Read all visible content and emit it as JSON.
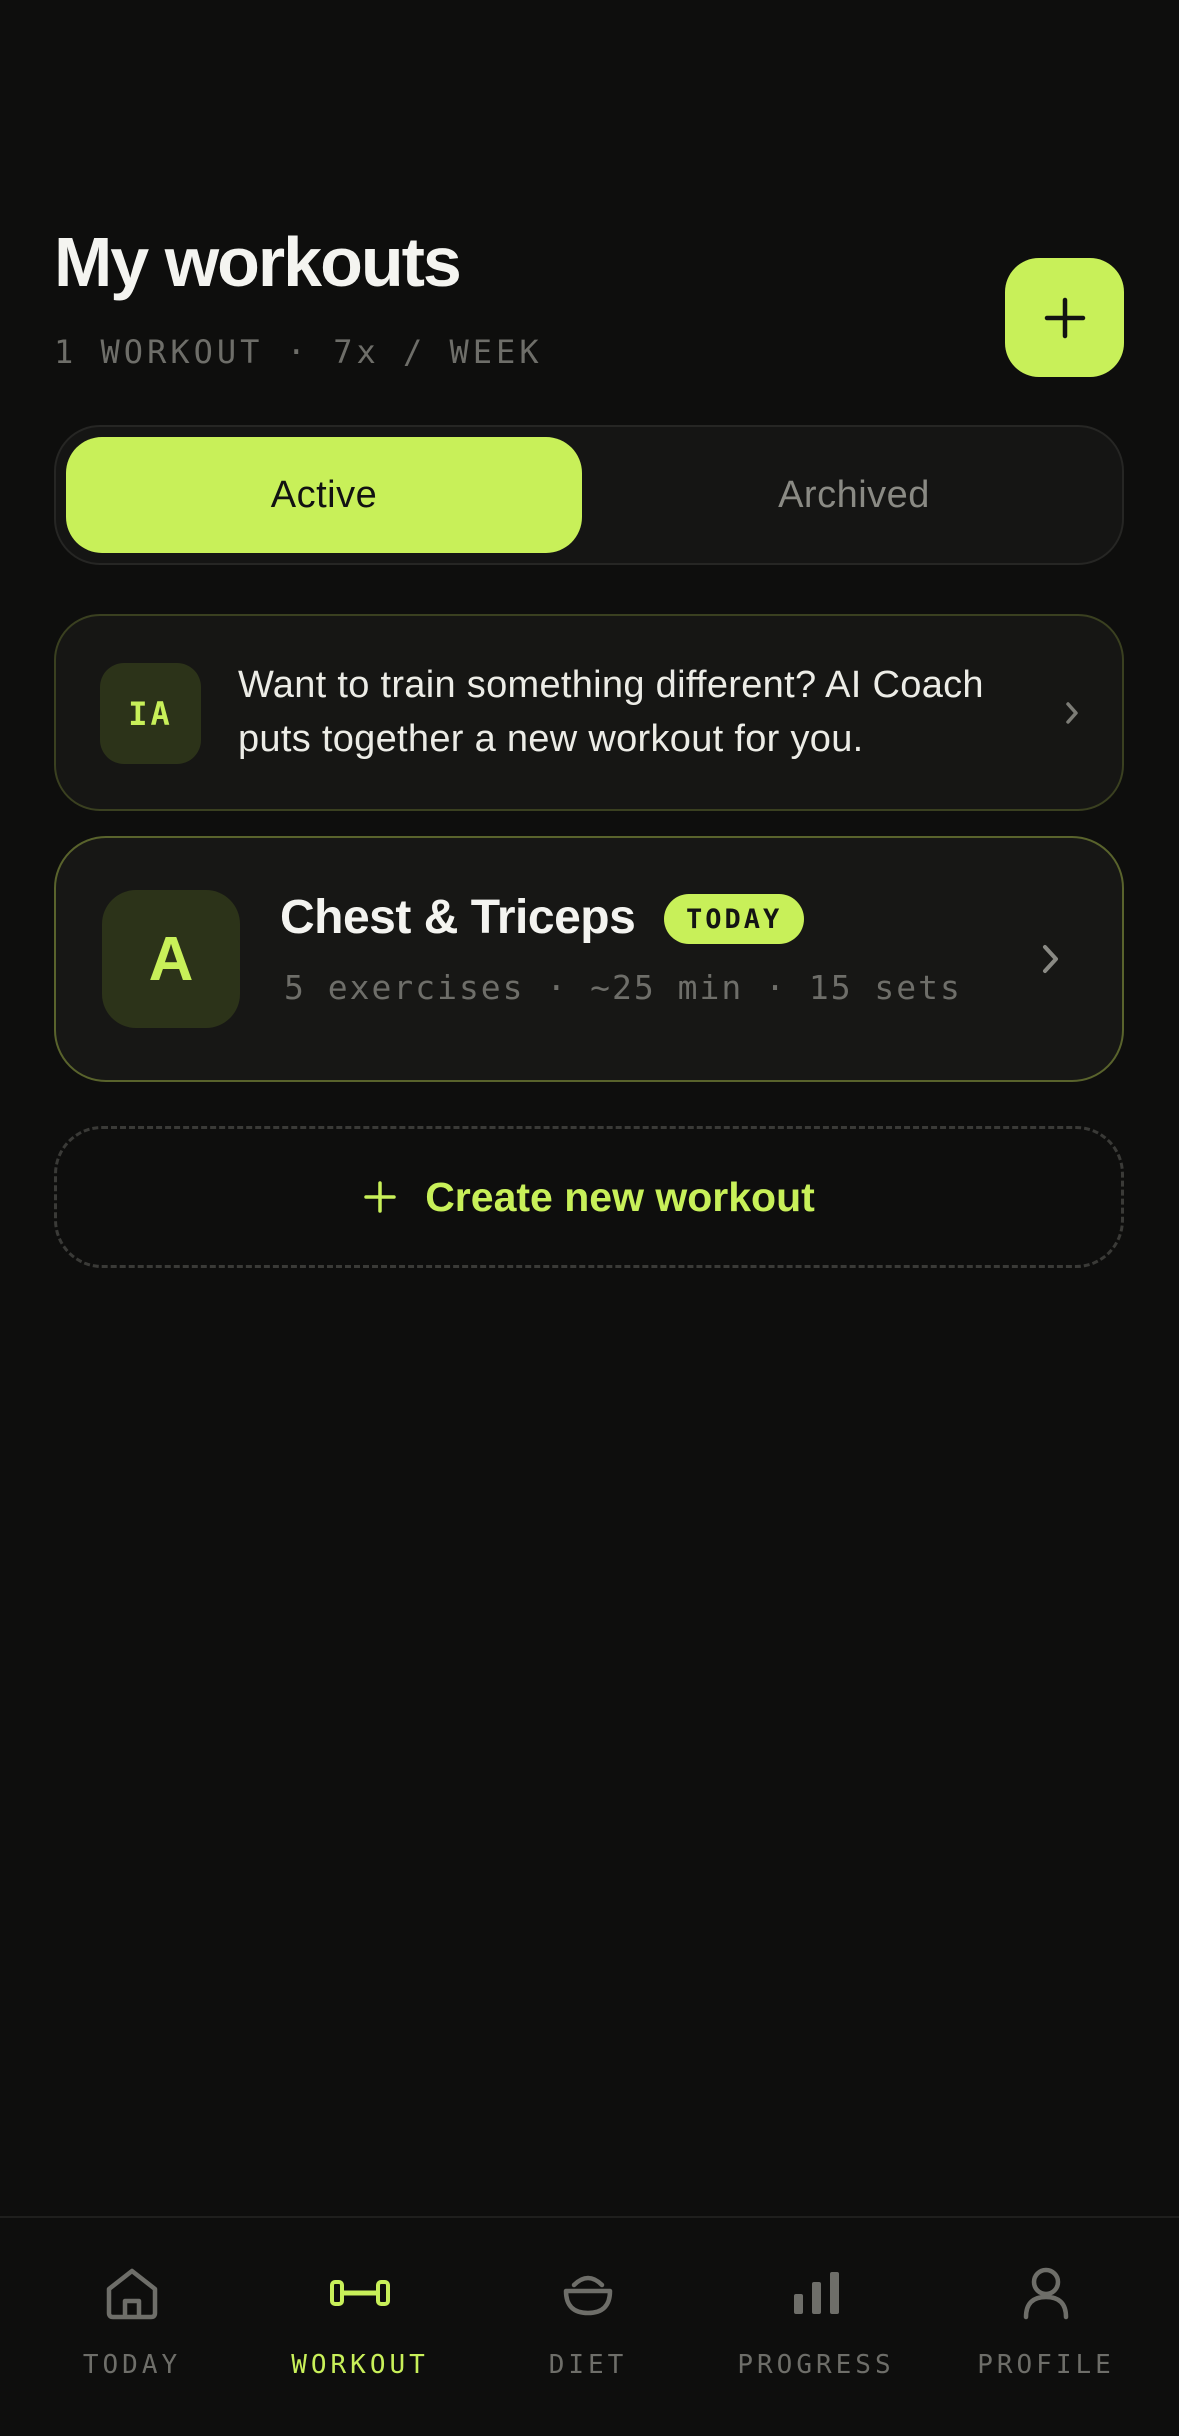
{
  "header": {
    "title": "My workouts",
    "subtitle": "1 WORKOUT · 7x / WEEK",
    "add_icon": "plus-icon"
  },
  "segment": {
    "active_label": "Active",
    "archived_label": "Archived",
    "selected": "Active"
  },
  "ai_card": {
    "badge": "IA",
    "text": "Want to train something different? AI Coach puts together a new workout for you.",
    "icon": "chevron-right-icon"
  },
  "workouts": [
    {
      "letter": "A",
      "name": "Chest & Triceps",
      "badge": "TODAY",
      "meta": "5 exercises · ~25 min · 15 sets"
    }
  ],
  "create": {
    "label": "Create new workout",
    "icon": "plus-icon"
  },
  "nav": {
    "items": [
      {
        "label": "TODAY",
        "icon": "home-icon"
      },
      {
        "label": "WORKOUT",
        "icon": "dumbbell-icon"
      },
      {
        "label": "DIET",
        "icon": "bowl-icon"
      },
      {
        "label": "PROGRESS",
        "icon": "bar-chart-icon"
      },
      {
        "label": "PROFILE",
        "icon": "person-icon"
      }
    ],
    "active": "WORKOUT"
  },
  "colors": {
    "accent": "#c8f059",
    "background": "#0e0e0d",
    "muted": "#6e6e69"
  }
}
